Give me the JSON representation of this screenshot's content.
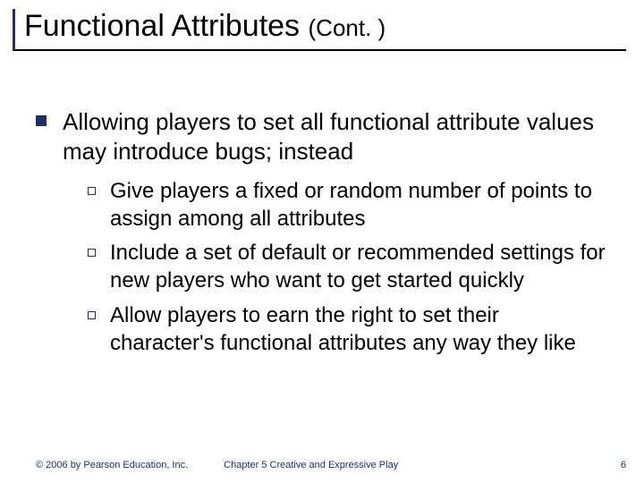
{
  "title": {
    "main": "Functional Attributes ",
    "cont": "(Cont. )"
  },
  "body": {
    "intro": "Allowing players to set all functional attribute values may introduce bugs; instead",
    "points": [
      "Give players a fixed or random number of points to assign among all attributes",
      "Include a set of default or recommended settings for new players who want to get started quickly",
      "Allow players to earn the right to set their character's functional attributes any way they like"
    ]
  },
  "footer": {
    "copyright": "© 2006 by Pearson Education, Inc.",
    "chapter": "Chapter 5   Creative and Expressive Play",
    "page": "6"
  },
  "colors": {
    "accent": "#1f2f63"
  }
}
